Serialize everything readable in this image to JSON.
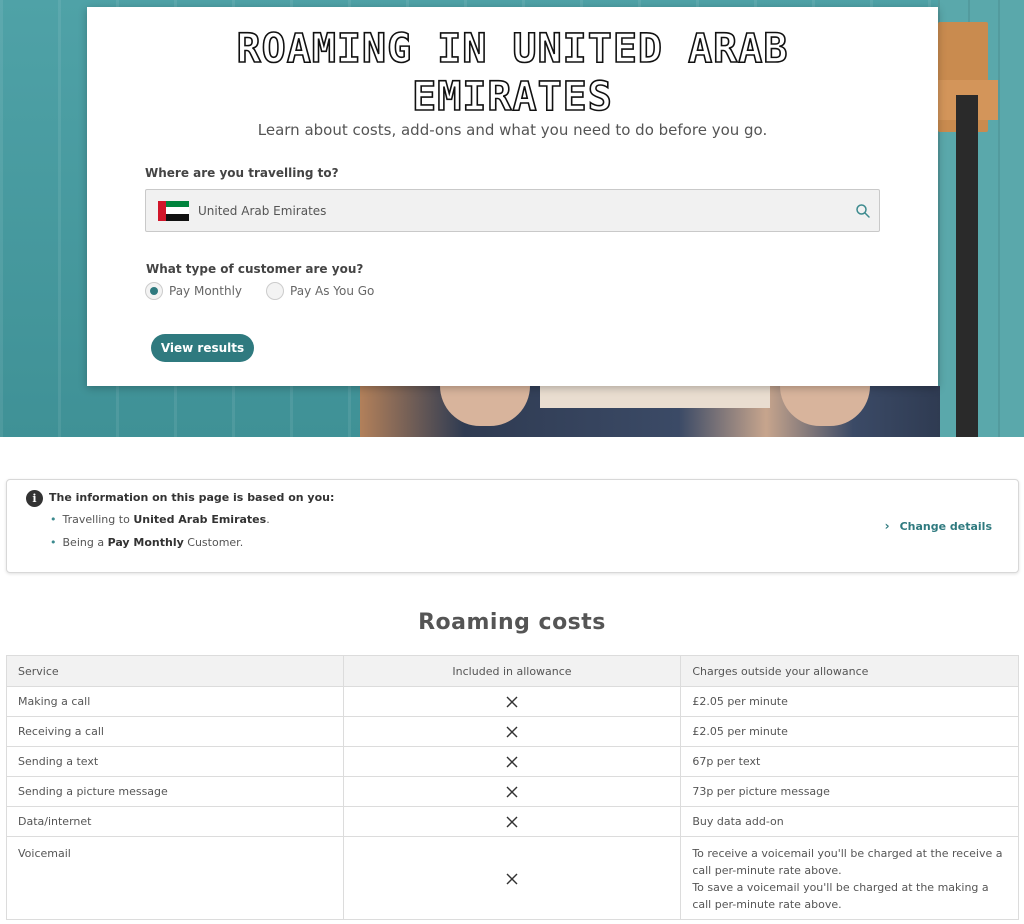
{
  "hero": {
    "title_line1": "ROAMING IN UNITED ARAB",
    "title_line2": "EMIRATES",
    "subtitle": "Learn about costs, add-ons and what you need to do before you go."
  },
  "form": {
    "destination_label": "Where are you travelling to?",
    "destination_value": "United Arab Emirates",
    "flag_colors": {
      "red": "#d1162a",
      "green": "#00843d",
      "white": "#ffffff",
      "black": "#111111"
    },
    "customer_label": "What type of customer are you?",
    "options": [
      {
        "label": "Pay Monthly",
        "checked": true
      },
      {
        "label": "Pay As You Go",
        "checked": false
      }
    ],
    "submit_label": "View results"
  },
  "info": {
    "heading": "The information on this page is based on you:",
    "travel_prefix": "Travelling to ",
    "travel_value": "United Arab Emirates",
    "travel_suffix": ".",
    "customer_prefix": "Being a ",
    "customer_value": "Pay Monthly",
    "customer_suffix": " Customer.",
    "change_label": "Change details"
  },
  "costs": {
    "title": "Roaming costs",
    "headers": [
      "Service",
      "Included in allowance",
      "Charges outside your allowance"
    ],
    "rows": [
      {
        "service": "Making a call",
        "included": false,
        "charge": "£2.05 per minute"
      },
      {
        "service": "Receiving a call",
        "included": false,
        "charge": "£2.05 per minute"
      },
      {
        "service": "Sending a text",
        "included": false,
        "charge": "67p per text"
      },
      {
        "service": "Sending a picture message",
        "included": false,
        "charge": "73p per picture message"
      },
      {
        "service": "Data/internet",
        "included": false,
        "charge": "Buy data add-on"
      },
      {
        "service": "Voicemail",
        "included": false,
        "charge_lines": [
          "To receive a voicemail you'll be charged at the receive a call per-minute rate above.",
          "To save a voicemail you'll be charged at the making a call per-minute rate above."
        ]
      }
    ]
  },
  "colors": {
    "accent": "#2f7a7f",
    "hero_teal": "#4fa2a7"
  },
  "icons": {
    "search": "search-icon",
    "info": "info-icon",
    "chevron": "chevron-right-icon",
    "not_included": "cross-icon"
  }
}
